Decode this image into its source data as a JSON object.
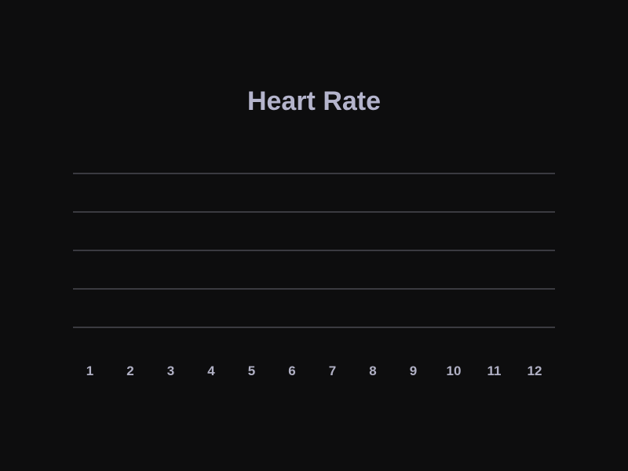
{
  "chart_data": {
    "type": "line",
    "title": "Heart Rate",
    "xlabel": "",
    "ylabel": "",
    "categories": [
      "1",
      "2",
      "3",
      "4",
      "5",
      "6",
      "7",
      "8",
      "9",
      "10",
      "11",
      "12"
    ],
    "series": [],
    "gridlines": 5,
    "grid": true,
    "legend": "none",
    "colors": {
      "background": "#0d0d0e",
      "title": "#b4b4cc",
      "tick_label": "#b0b0c4",
      "gridline": "#3a3a40"
    }
  }
}
